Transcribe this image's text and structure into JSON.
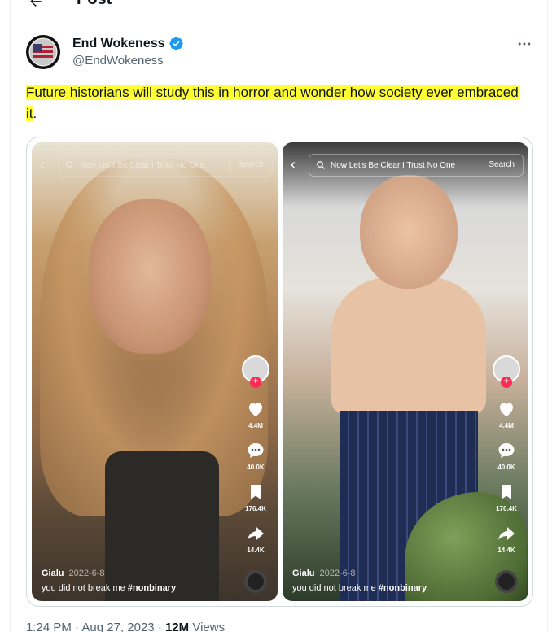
{
  "page": {
    "title": "Post"
  },
  "author": {
    "name": "End Wokeness",
    "handle": "@EndWokeness",
    "verified": true,
    "verified_color": "#1d9bf0"
  },
  "tweet": {
    "text_highlighted": "Future historians will study this in horror and wonder how society ever embraced it",
    "text_tail": ".",
    "highlight_color": "#ffff33"
  },
  "media": {
    "videos": [
      {
        "search_text": "Now Let's Be Clear I Trust No One",
        "search_button": "Search",
        "likes": "4.4M",
        "comments": "40.0K",
        "saves": "176.4K",
        "shares": "14.4K",
        "username": "Gialu",
        "date": "2022-6-8",
        "caption": "you did not break me",
        "hashtag": "#nonbinary"
      },
      {
        "search_text": "Now Let's Be Clear I Trust No One",
        "search_button": "Search",
        "likes": "4.4M",
        "comments": "40.0K",
        "saves": "176.4K",
        "shares": "14.4K",
        "username": "Gialu",
        "date": "2022-6-8",
        "caption": "you did not break me",
        "hashtag": "#nonbinary"
      }
    ]
  },
  "meta": {
    "time": "1:24 PM",
    "separator": "·",
    "date": "Aug 27, 2023",
    "views_count": "12M",
    "views_label": "Views"
  },
  "icons": {
    "back": "arrow-left-icon",
    "verified": "verified-badge-icon",
    "more": "more-horizontal-icon",
    "like": "heart-icon",
    "comment": "comment-icon",
    "save": "bookmark-icon",
    "share": "share-arrow-icon"
  }
}
